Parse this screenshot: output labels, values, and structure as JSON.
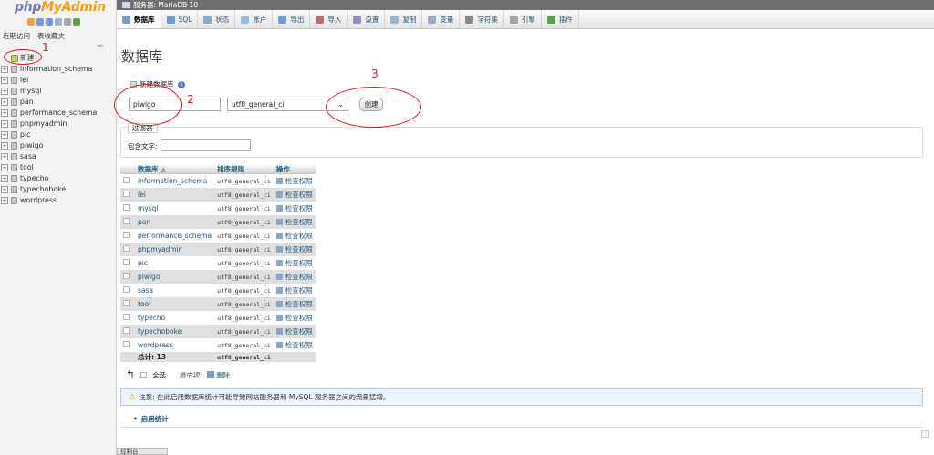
{
  "logo": {
    "php": "php",
    "admin": "MyAdmin"
  },
  "nav": {
    "recent": "近期访问",
    "favorites": "表收藏夹",
    "new": "新建",
    "databases": [
      "information_schema",
      "lei",
      "mysql",
      "pan",
      "performance_schema",
      "phpmyadmin",
      "pic",
      "piwigo",
      "sasa",
      "tool",
      "typecho",
      "typechoboke",
      "wordpress"
    ]
  },
  "serverbar": {
    "label": "服务器: MariaDB 10"
  },
  "tabs": [
    "数据库",
    "SQL",
    "状态",
    "账户",
    "导出",
    "导入",
    "设置",
    "复制",
    "变量",
    "字符集",
    "引擎",
    "插件"
  ],
  "main": {
    "title": "数据库",
    "create_label": "新建数据库",
    "db_name_value": "piwigo",
    "collation": "utf8_general_ci",
    "create_button": "创建",
    "filter_legend": "过滤器",
    "filter_label": "包含文字:",
    "table_headers": {
      "db": "数据库",
      "collation": "排序规则",
      "action": "操作"
    },
    "rows": [
      {
        "name": "information_schema",
        "collation": "utf8_general_ci",
        "action": "检查权限"
      },
      {
        "name": "lei",
        "collation": "utf8_general_ci",
        "action": "检查权限"
      },
      {
        "name": "mysql",
        "collation": "utf8_general_ci",
        "action": "检查权限"
      },
      {
        "name": "pan",
        "collation": "utf8_general_ci",
        "action": "检查权限"
      },
      {
        "name": "performance_schema",
        "collation": "utf8_general_ci",
        "action": "检查权限"
      },
      {
        "name": "phpmyadmin",
        "collation": "utf8_general_ci",
        "action": "检查权限"
      },
      {
        "name": "pic",
        "collation": "utf8_general_ci",
        "action": "检查权限"
      },
      {
        "name": "piwigo",
        "collation": "utf8_general_ci",
        "action": "检查权限"
      },
      {
        "name": "sasa",
        "collation": "utf8_general_ci",
        "action": "检查权限"
      },
      {
        "name": "tool",
        "collation": "utf8_general_ci",
        "action": "检查权限"
      },
      {
        "name": "typecho",
        "collation": "utf8_general_ci",
        "action": "检查权限"
      },
      {
        "name": "typechoboke",
        "collation": "utf8_general_ci",
        "action": "检查权限"
      },
      {
        "name": "wordpress",
        "collation": "utf8_general_ci",
        "action": "检查权限"
      }
    ],
    "total_label": "总计: 13",
    "total_collation": "utf8_general_ci",
    "select_all": "全选",
    "with_selected": "选中项:",
    "delete": "删除",
    "notice": "注意: 在此启用数据库统计可能导致网站服务器和 MySQL 服务器之间的流量猛增。",
    "enable_stats": "启用统计",
    "console": "控制台"
  },
  "annotations": [
    "1",
    "2",
    "3"
  ]
}
